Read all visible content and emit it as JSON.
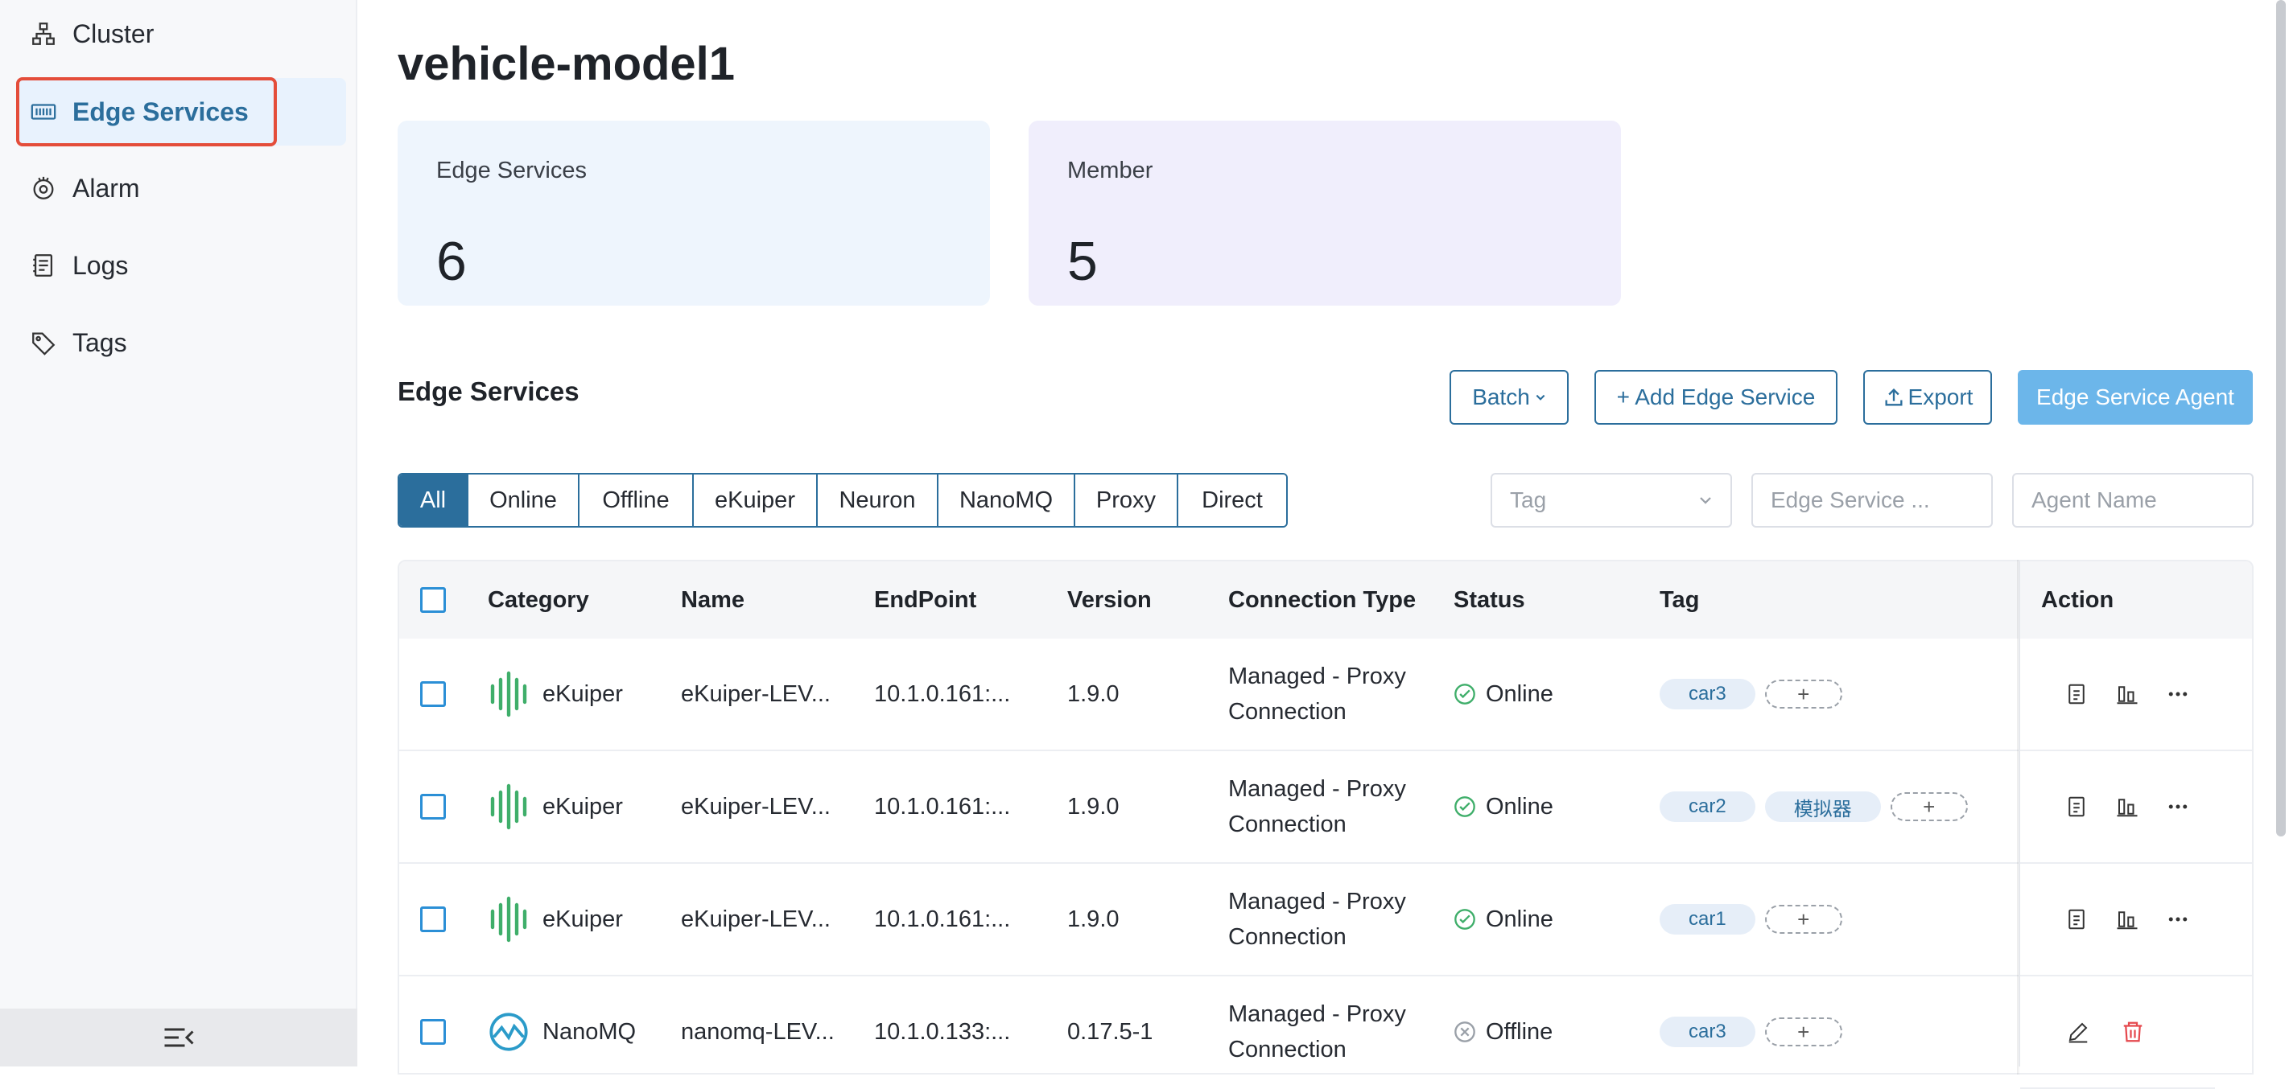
{
  "sidebar": {
    "items": [
      {
        "label": "Cluster",
        "icon": "cluster-icon"
      },
      {
        "label": "Edge Services",
        "icon": "edge-services-icon",
        "active": true
      },
      {
        "label": "Alarm",
        "icon": "alarm-icon"
      },
      {
        "label": "Logs",
        "icon": "logs-icon"
      },
      {
        "label": "Tags",
        "icon": "tag-icon"
      }
    ],
    "collapse_icon": "collapse-menu-icon"
  },
  "page": {
    "title": "vehicle-model1"
  },
  "stats": [
    {
      "label": "Edge Services",
      "value": "6"
    },
    {
      "label": "Member",
      "value": "5"
    }
  ],
  "section": {
    "title": "Edge Services"
  },
  "toolbar": {
    "batch_label": "Batch",
    "add_label": "+ Add Edge Service",
    "export_label": "Export",
    "agent_label": "Edge Service Agent"
  },
  "filters": [
    "All",
    "Online",
    "Offline",
    "eKuiper",
    "Neuron",
    "NanoMQ",
    "Proxy",
    "Direct"
  ],
  "active_filter": "All",
  "search": {
    "tag_placeholder": "Tag",
    "name_placeholder": "Edge Service ...",
    "agent_placeholder": "Agent Name"
  },
  "table": {
    "columns": {
      "category": "Category",
      "name": "Name",
      "endpoint": "EndPoint",
      "version": "Version",
      "connection_type": "Connection Type",
      "status": "Status",
      "tag": "Tag",
      "action": "Action"
    },
    "rows": [
      {
        "category": "eKuiper",
        "name": "eKuiper-LEV...",
        "endpoint": "10.1.0.161:...",
        "version": "1.9.0",
        "connection_line1": "Managed - Proxy",
        "connection_line2": "Connection",
        "status": "Online",
        "tags": [
          "car3"
        ]
      },
      {
        "category": "eKuiper",
        "name": "eKuiper-LEV...",
        "endpoint": "10.1.0.161:...",
        "version": "1.9.0",
        "connection_line1": "Managed - Proxy",
        "connection_line2": "Connection",
        "status": "Online",
        "tags": [
          "car2",
          "模拟器"
        ]
      },
      {
        "category": "eKuiper",
        "name": "eKuiper-LEV...",
        "endpoint": "10.1.0.161:...",
        "version": "1.9.0",
        "connection_line1": "Managed - Proxy",
        "connection_line2": "Connection",
        "status": "Online",
        "tags": [
          "car1"
        ]
      },
      {
        "category": "NanoMQ",
        "name": "nanomq-LEV...",
        "endpoint": "10.1.0.133:...",
        "version": "0.17.5-1",
        "connection_line1": "Managed - Proxy",
        "connection_line2": "Connection",
        "status": "Offline",
        "tags": [
          "car3"
        ]
      }
    ],
    "tag_add_label": "+"
  },
  "colors": {
    "primary": "#2b6e9c",
    "online": "#3fae6a",
    "offline": "#9aa0a8",
    "danger": "#e5484d",
    "highlight_frame": "#e44d3a"
  }
}
